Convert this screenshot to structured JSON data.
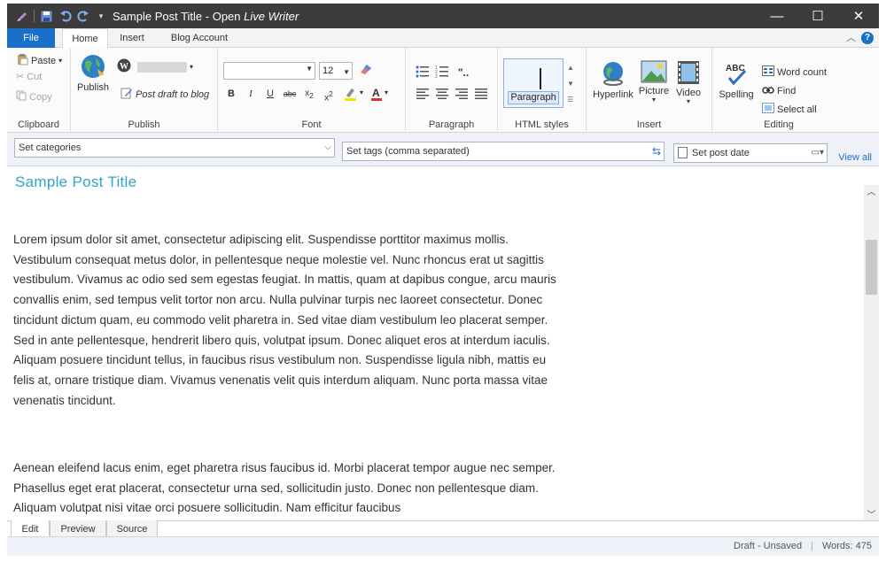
{
  "window": {
    "title_plain": "Sample Post Title - Open ",
    "title_italic": "Live Writer",
    "controls": {
      "minimize": "—",
      "maximize": "☐",
      "close": "✕"
    }
  },
  "ribbon_tabs": [
    "File",
    "Home",
    "Insert",
    "Blog Account"
  ],
  "clipboard": {
    "paste": "Paste",
    "cut": "Cut",
    "copy": "Copy",
    "label": "Clipboard"
  },
  "publish": {
    "publish": "Publish",
    "post_draft": "Post draft to blog",
    "label": "Publish"
  },
  "font": {
    "size": "12",
    "label": "Font"
  },
  "paragraph": {
    "label": "Paragraph"
  },
  "html_styles": {
    "style": "Paragraph",
    "label": "HTML styles"
  },
  "insert": {
    "hyperlink": "Hyperlink",
    "picture": "Picture",
    "video": "Video",
    "label": "Insert"
  },
  "editing": {
    "spelling": "Spelling",
    "spelling_badge": "ABC",
    "word_count": "Word count",
    "find": "Find",
    "select_all": "Select all",
    "label": "Editing"
  },
  "properties": {
    "categories_placeholder": "Set categories",
    "tags_placeholder": "Set tags (comma separated)",
    "post_date": "Set post date",
    "view_all": "View all"
  },
  "post": {
    "title": "Sample Post Title",
    "paragraphs": [
      "Lorem ipsum dolor sit amet, consectetur adipiscing elit. Suspendisse porttitor maximus mollis. Vestibulum consequat metus dolor, in pellentesque neque molestie vel. Nunc rhoncus erat ut sagittis vestibulum. Vivamus ac odio sed sem egestas feugiat. In mattis, quam at dapibus congue, arcu mauris convallis enim, sed tempus velit tortor non arcu. Nulla pulvinar turpis nec laoreet consectetur. Donec tincidunt dictum quam, eu commodo velit pharetra in. Sed vitae diam vestibulum leo placerat semper. Sed in ante pellentesque, hendrerit libero quis, volutpat ipsum. Donec aliquet eros at interdum iaculis. Aliquam posuere tincidunt tellus, in faucibus risus vestibulum non. Suspendisse ligula nibh, mattis eu felis at, ornare tristique diam. Vivamus venenatis velit quis interdum aliquam. Nunc porta massa vitae venenatis tincidunt.",
      "Aenean eleifend lacus enim, eget pharetra risus faucibus id. Morbi placerat tempor augue nec semper. Phasellus eget erat placerat, consectetur urna sed, sollicitudin justo. Donec non pellentesque diam. Aliquam volutpat nisi vitae orci posuere sollicitudin. Nam efficitur faucibus"
    ]
  },
  "view_tabs": [
    "Edit",
    "Preview",
    "Source"
  ],
  "status": {
    "state": "Draft - Unsaved",
    "words": "Words: 475"
  },
  "colors": {
    "accent": "#1a6fc9",
    "title_bar": "#3c3c3c",
    "post_title": "#2fa4c6"
  }
}
